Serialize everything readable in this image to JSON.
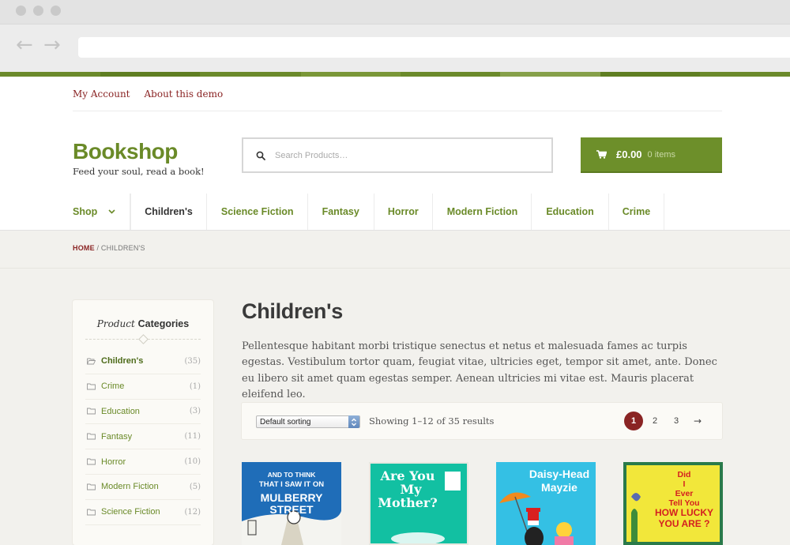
{
  "browser": {
    "back_glyph": "←",
    "forward_glyph": "→"
  },
  "top_links": [
    "My Account",
    "About this demo"
  ],
  "site": {
    "title": "Bookshop",
    "tagline": "Feed your soul, read a book!"
  },
  "search": {
    "placeholder": "Search Products…"
  },
  "cart": {
    "amount": "£0.00",
    "items": "0 items"
  },
  "nav": [
    {
      "label": "Shop"
    },
    {
      "label": "Children's"
    },
    {
      "label": "Science Fiction"
    },
    {
      "label": "Fantasy"
    },
    {
      "label": "Horror"
    },
    {
      "label": "Modern Fiction"
    },
    {
      "label": "Education"
    },
    {
      "label": "Crime"
    }
  ],
  "breadcrumb": {
    "home": "HOME",
    "sep": " / ",
    "current": "CHILDREN'S"
  },
  "sidebar": {
    "title_italic": "Product",
    "title_bold": "Categories",
    "categories": [
      {
        "name": "Children's",
        "count": "(35)"
      },
      {
        "name": "Crime",
        "count": "(1)"
      },
      {
        "name": "Education",
        "count": "(3)"
      },
      {
        "name": "Fantasy",
        "count": "(11)"
      },
      {
        "name": "Horror",
        "count": "(10)"
      },
      {
        "name": "Modern Fiction",
        "count": "(5)"
      },
      {
        "name": "Science Fiction",
        "count": "(12)"
      }
    ]
  },
  "page": {
    "title": "Children's",
    "description": "Pellentesque habitant morbi tristique senectus et netus et malesuada fames ac turpis egestas. Vestibulum tortor quam, feugiat vitae, ultricies eget, tempor sit amet, ante. Donec eu libero sit amet quam egestas semper. Aenean ultricies mi vitae est. Mauris placerat eleifend leo."
  },
  "toolbar": {
    "sorting": "Default sorting",
    "result_count": "Showing 1–12 of 35 results",
    "pages": [
      "1",
      "2",
      "3"
    ],
    "next": "→"
  },
  "products": [
    {
      "cover_lines": [
        "AND TO THINK",
        "THAT I SAW IT ON",
        "MULBERRY STREET"
      ]
    },
    {
      "cover_lines": [
        "Are You",
        "My",
        "Mother?"
      ]
    },
    {
      "cover_lines": [
        "Daisy-Head",
        "Mayzie"
      ]
    },
    {
      "cover_lines": [
        "Did",
        "I",
        "Ever",
        "Tell You",
        "HOW LUCKY",
        "YOU ARE ?"
      ]
    }
  ],
  "colors": {
    "brand_green": "#6a8a28",
    "accent_red": "#8a2424",
    "cart_bg": "#6d8f2a"
  }
}
